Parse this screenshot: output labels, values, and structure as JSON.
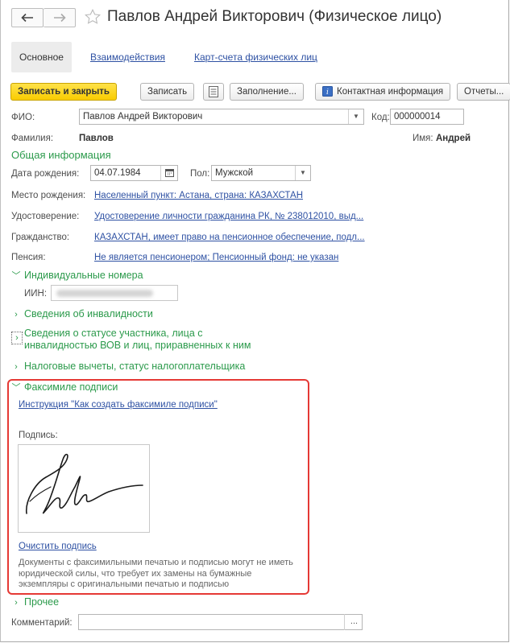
{
  "window": {
    "title": "Павлов Андрей Викторович (Физическое лицо)",
    "back_icon": "arrow-left-icon",
    "forward_icon": "arrow-right-icon",
    "favorite_icon": "star-icon"
  },
  "tabs": [
    {
      "label": "Основное",
      "active": true
    },
    {
      "label": "Взаимодействия",
      "active": false
    },
    {
      "label": "Карт-счета физических лиц",
      "active": false
    }
  ],
  "toolbar": {
    "save_close": "Записать и закрыть",
    "save": "Записать",
    "fill": "Заполнение...",
    "contact_info": "Контактная информация",
    "reports": "Отчеты..."
  },
  "form": {
    "fio_label": "ФИО:",
    "fio_value": "Павлов Андрей Викторович",
    "code_label": "Код:",
    "code_value": "000000014",
    "surname_label": "Фамилия:",
    "surname_value": "Павлов",
    "name_label": "Имя:",
    "name_value": "Андрей"
  },
  "general": {
    "header": "Общая информация",
    "birth_label": "Дата рождения:",
    "birth_value": "04.07.1984",
    "gender_label": "Пол:",
    "gender_value": "Мужской",
    "birthplace_label": "Место рождения:",
    "birthplace_value": "Населенный пункт: Астана, страна: КАЗАХСТАН",
    "id_label": "Удостоверение:",
    "id_value": "Удостоверение личности гражданина РК, № 238012010, выд...",
    "citizenship_label": "Гражданство:",
    "citizenship_value": "КАЗАХСТАН, имеет право на пенсионное обеспечение, подл...",
    "pension_label": "Пенсия:",
    "pension_value": "Не является пенсионером; Пенсионный фонд: не указан"
  },
  "sections": {
    "individual_numbers": "Индивидуальные номера",
    "iin_label": "ИИН:",
    "disability": "Сведения об инвалидности",
    "wwii_line1": "Сведения о статусе участника, лица с",
    "wwii_line2": "инвалидностью ВОВ и лиц, приравненных к ним",
    "tax": "Налоговые вычеты, статус налогоплательщика",
    "facsimile": "Факсимиле подписи",
    "other": "Прочее"
  },
  "facsimile": {
    "instruction_link": "Инструкция \"Как создать факсимиле подписи\"",
    "signature_label": "Подпись:",
    "clear_link": "Очистить подпись",
    "note": "Документы с факсимильными печатью и подписью могут не иметь юридической силы, что требует их замены на бумажные экземпляры с оригинальными печатью и подписью"
  },
  "comment": {
    "label": "Комментарий:",
    "value": ""
  },
  "colors": {
    "accent_green": "#2b9a4b",
    "link_blue": "#2e51a3",
    "primary_button": "#f9cc00",
    "highlight_red": "#e53935"
  }
}
